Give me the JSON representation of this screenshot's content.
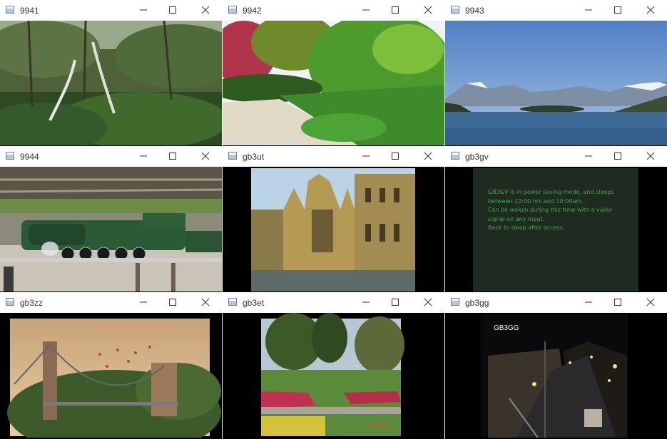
{
  "windows": [
    {
      "title": "9941",
      "icon": "app-window-icon"
    },
    {
      "title": "9942",
      "icon": "app-window-icon"
    },
    {
      "title": "9943",
      "icon": "app-window-icon"
    },
    {
      "title": "9944",
      "icon": "app-window-icon"
    },
    {
      "title": "gb3ut",
      "icon": "app-window-icon"
    },
    {
      "title": "gb3gv",
      "icon": "app-window-icon",
      "osd_lines": [
        "GB3GV is in power saving mode, and sleeps",
        "between 22:00 hrs and 10:00am.",
        "Can be woken during this time with a video",
        "signal on any input.",
        "Back to sleep after access."
      ]
    },
    {
      "title": "gb3zz",
      "icon": "app-window-icon"
    },
    {
      "title": "gb3et",
      "icon": "app-window-icon",
      "datestamp": "2-5 002"
    },
    {
      "title": "gb3gg",
      "icon": "app-window-icon",
      "callsign": "GB3GG"
    }
  ],
  "colors": {
    "titlebar_bg": "#ffffff",
    "osd_text": "#3fa844",
    "window_bg": "#000000"
  }
}
